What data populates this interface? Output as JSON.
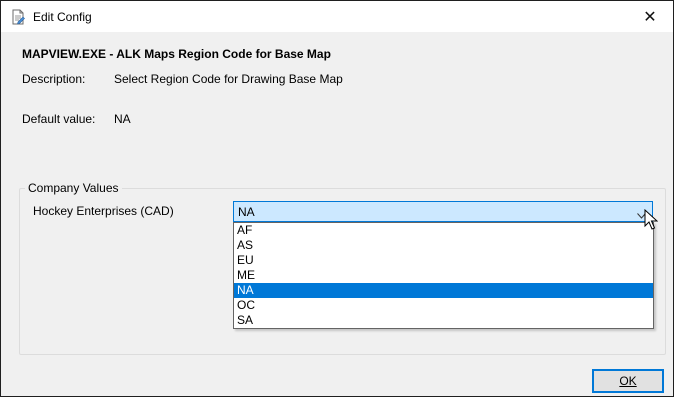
{
  "window": {
    "title": "Edit Config",
    "close_glyph": "✕",
    "icon": "document-edit-icon"
  },
  "main": {
    "heading": "MAPVIEW.EXE - ALK Maps Region Code for Base Map",
    "description_label": "Description:",
    "description_value": "Select Region Code for Drawing Base Map",
    "default_label": "Default value:",
    "default_value": "NA"
  },
  "company_values": {
    "group_title": "Company Values",
    "company_label": "Hockey Enterprises (CAD)",
    "selected_value": "NA",
    "options": [
      "AF",
      "AS",
      "EU",
      "ME",
      "NA",
      "OC",
      "SA"
    ],
    "selected_option": "NA"
  },
  "footer": {
    "ok_label": "OK"
  },
  "colors": {
    "accent": "#0078d7",
    "combo_bg": "#cce8ff",
    "dialog_bg": "#f0f0f0"
  }
}
